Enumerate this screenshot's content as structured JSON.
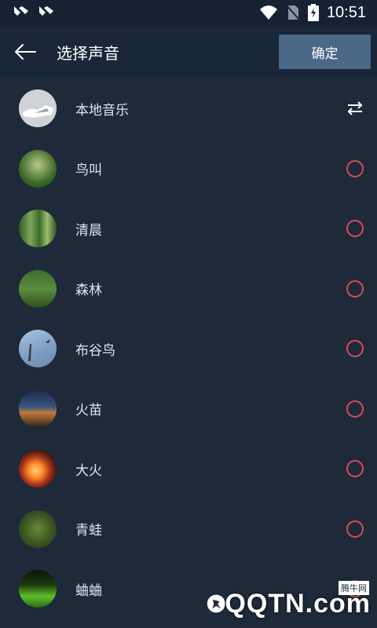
{
  "statusbar": {
    "time": "10:51"
  },
  "header": {
    "title": "选择声音",
    "confirm_label": "确定"
  },
  "items": [
    {
      "label": "本地音乐",
      "action": "swap"
    },
    {
      "label": "鸟叫",
      "action": "radio"
    },
    {
      "label": "清晨",
      "action": "radio"
    },
    {
      "label": "森林",
      "action": "radio"
    },
    {
      "label": "布谷鸟",
      "action": "radio"
    },
    {
      "label": "火苗",
      "action": "radio"
    },
    {
      "label": "大火",
      "action": "radio"
    },
    {
      "label": "青蛙",
      "action": "radio"
    },
    {
      "label": "蛐蛐",
      "action": "radio"
    }
  ],
  "watermark": {
    "text": "QQTN.com",
    "sub": "腾牛网"
  },
  "colors": {
    "background": "#1e2a3a",
    "header": "#1a2738",
    "button": "#4b6887",
    "radio": "#d94a57"
  }
}
